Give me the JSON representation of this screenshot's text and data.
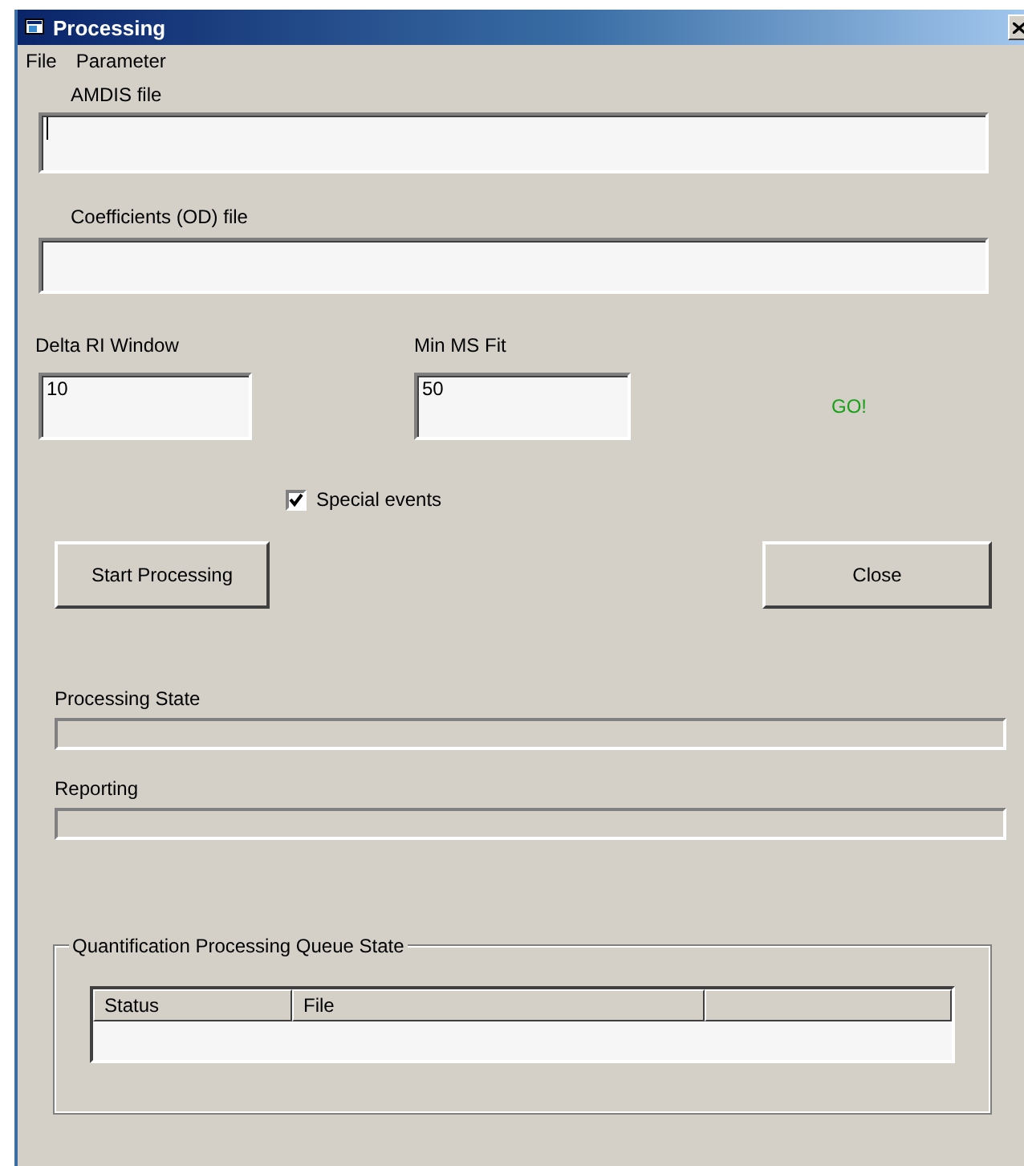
{
  "window": {
    "title": "Processing"
  },
  "menu": [
    "File",
    "Parameter"
  ],
  "amdis_file": {
    "label": "AMDIS file"
  },
  "coefficients_file": {
    "label": "Coefficients (OD) file"
  },
  "delta_ri_window": {
    "label": "Delta RI Window",
    "value": "10"
  },
  "min_ms_fit": {
    "label": "Min MS Fit",
    "value": "50"
  },
  "status_text": "GO!",
  "special_events": {
    "label": "Special events",
    "checked": true
  },
  "buttons": {
    "start": "Start Processing",
    "close": "Close"
  },
  "progress": [
    {
      "label": "Processing State",
      "level": 0
    },
    {
      "label": "Reporting",
      "level": 0
    }
  ],
  "queue": {
    "title": "Quantification Processing Queue State",
    "columns": [
      "Status",
      "File"
    ]
  }
}
